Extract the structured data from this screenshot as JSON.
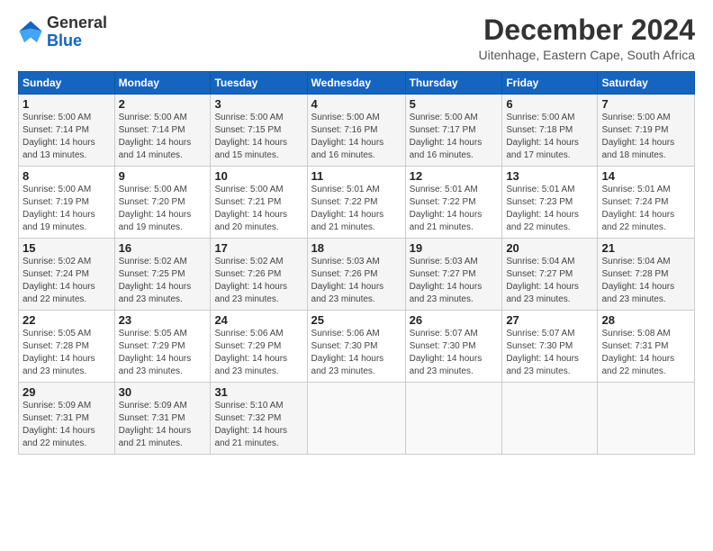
{
  "header": {
    "logo_general": "General",
    "logo_blue": "Blue",
    "title": "December 2024",
    "subtitle": "Uitenhage, Eastern Cape, South Africa"
  },
  "calendar": {
    "days_of_week": [
      "Sunday",
      "Monday",
      "Tuesday",
      "Wednesday",
      "Thursday",
      "Friday",
      "Saturday"
    ],
    "weeks": [
      [
        {
          "day": "1",
          "info": "Sunrise: 5:00 AM\nSunset: 7:14 PM\nDaylight: 14 hours\nand 13 minutes."
        },
        {
          "day": "2",
          "info": "Sunrise: 5:00 AM\nSunset: 7:14 PM\nDaylight: 14 hours\nand 14 minutes."
        },
        {
          "day": "3",
          "info": "Sunrise: 5:00 AM\nSunset: 7:15 PM\nDaylight: 14 hours\nand 15 minutes."
        },
        {
          "day": "4",
          "info": "Sunrise: 5:00 AM\nSunset: 7:16 PM\nDaylight: 14 hours\nand 16 minutes."
        },
        {
          "day": "5",
          "info": "Sunrise: 5:00 AM\nSunset: 7:17 PM\nDaylight: 14 hours\nand 16 minutes."
        },
        {
          "day": "6",
          "info": "Sunrise: 5:00 AM\nSunset: 7:18 PM\nDaylight: 14 hours\nand 17 minutes."
        },
        {
          "day": "7",
          "info": "Sunrise: 5:00 AM\nSunset: 7:19 PM\nDaylight: 14 hours\nand 18 minutes."
        }
      ],
      [
        {
          "day": "8",
          "info": "Sunrise: 5:00 AM\nSunset: 7:19 PM\nDaylight: 14 hours\nand 19 minutes."
        },
        {
          "day": "9",
          "info": "Sunrise: 5:00 AM\nSunset: 7:20 PM\nDaylight: 14 hours\nand 19 minutes."
        },
        {
          "day": "10",
          "info": "Sunrise: 5:00 AM\nSunset: 7:21 PM\nDaylight: 14 hours\nand 20 minutes."
        },
        {
          "day": "11",
          "info": "Sunrise: 5:01 AM\nSunset: 7:22 PM\nDaylight: 14 hours\nand 21 minutes."
        },
        {
          "day": "12",
          "info": "Sunrise: 5:01 AM\nSunset: 7:22 PM\nDaylight: 14 hours\nand 21 minutes."
        },
        {
          "day": "13",
          "info": "Sunrise: 5:01 AM\nSunset: 7:23 PM\nDaylight: 14 hours\nand 22 minutes."
        },
        {
          "day": "14",
          "info": "Sunrise: 5:01 AM\nSunset: 7:24 PM\nDaylight: 14 hours\nand 22 minutes."
        }
      ],
      [
        {
          "day": "15",
          "info": "Sunrise: 5:02 AM\nSunset: 7:24 PM\nDaylight: 14 hours\nand 22 minutes."
        },
        {
          "day": "16",
          "info": "Sunrise: 5:02 AM\nSunset: 7:25 PM\nDaylight: 14 hours\nand 23 minutes."
        },
        {
          "day": "17",
          "info": "Sunrise: 5:02 AM\nSunset: 7:26 PM\nDaylight: 14 hours\nand 23 minutes."
        },
        {
          "day": "18",
          "info": "Sunrise: 5:03 AM\nSunset: 7:26 PM\nDaylight: 14 hours\nand 23 minutes."
        },
        {
          "day": "19",
          "info": "Sunrise: 5:03 AM\nSunset: 7:27 PM\nDaylight: 14 hours\nand 23 minutes."
        },
        {
          "day": "20",
          "info": "Sunrise: 5:04 AM\nSunset: 7:27 PM\nDaylight: 14 hours\nand 23 minutes."
        },
        {
          "day": "21",
          "info": "Sunrise: 5:04 AM\nSunset: 7:28 PM\nDaylight: 14 hours\nand 23 minutes."
        }
      ],
      [
        {
          "day": "22",
          "info": "Sunrise: 5:05 AM\nSunset: 7:28 PM\nDaylight: 14 hours\nand 23 minutes."
        },
        {
          "day": "23",
          "info": "Sunrise: 5:05 AM\nSunset: 7:29 PM\nDaylight: 14 hours\nand 23 minutes."
        },
        {
          "day": "24",
          "info": "Sunrise: 5:06 AM\nSunset: 7:29 PM\nDaylight: 14 hours\nand 23 minutes."
        },
        {
          "day": "25",
          "info": "Sunrise: 5:06 AM\nSunset: 7:30 PM\nDaylight: 14 hours\nand 23 minutes."
        },
        {
          "day": "26",
          "info": "Sunrise: 5:07 AM\nSunset: 7:30 PM\nDaylight: 14 hours\nand 23 minutes."
        },
        {
          "day": "27",
          "info": "Sunrise: 5:07 AM\nSunset: 7:30 PM\nDaylight: 14 hours\nand 23 minutes."
        },
        {
          "day": "28",
          "info": "Sunrise: 5:08 AM\nSunset: 7:31 PM\nDaylight: 14 hours\nand 22 minutes."
        }
      ],
      [
        {
          "day": "29",
          "info": "Sunrise: 5:09 AM\nSunset: 7:31 PM\nDaylight: 14 hours\nand 22 minutes."
        },
        {
          "day": "30",
          "info": "Sunrise: 5:09 AM\nSunset: 7:31 PM\nDaylight: 14 hours\nand 21 minutes."
        },
        {
          "day": "31",
          "info": "Sunrise: 5:10 AM\nSunset: 7:32 PM\nDaylight: 14 hours\nand 21 minutes."
        },
        {
          "day": "",
          "info": ""
        },
        {
          "day": "",
          "info": ""
        },
        {
          "day": "",
          "info": ""
        },
        {
          "day": "",
          "info": ""
        }
      ]
    ]
  }
}
